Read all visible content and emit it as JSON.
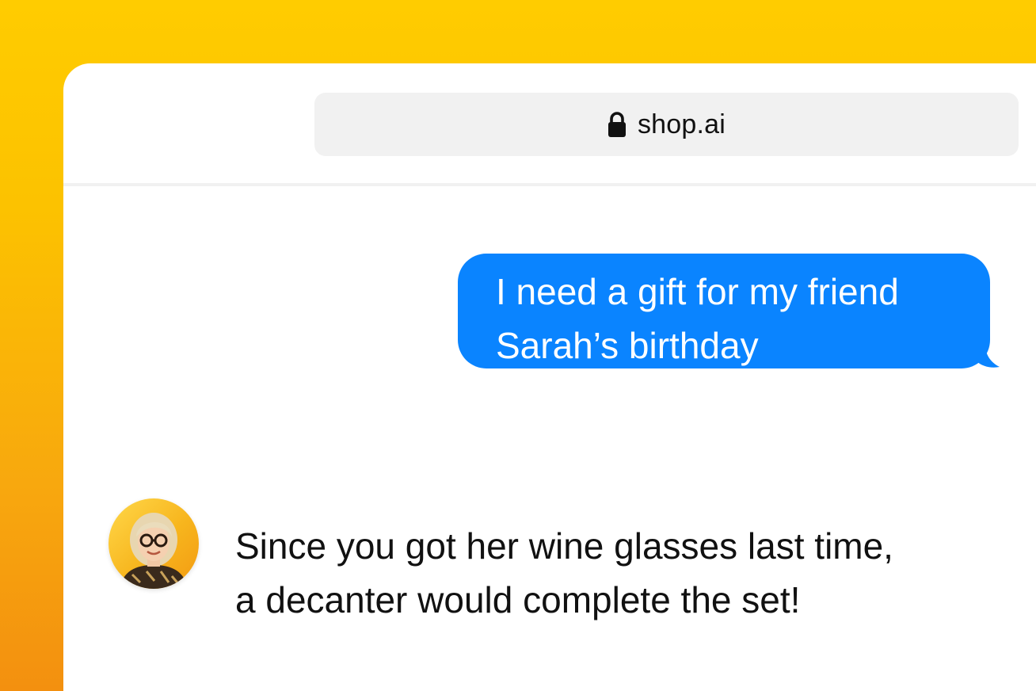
{
  "browser": {
    "address_bar": {
      "icon": "lock-icon",
      "url": "shop.ai"
    }
  },
  "chat": {
    "messages": [
      {
        "role": "user",
        "text": "I need a gift for my friend\nSarah’s birthday",
        "bubble_color": "#0a84ff"
      },
      {
        "role": "assistant",
        "avatar": "assistant-avatar",
        "text": "Since you got her wine glasses last time,\na decanter would complete the set!"
      }
    ]
  },
  "colors": {
    "background_top": "#ffcc00",
    "background_bottom": "#f3900f",
    "window": "#ffffff",
    "address_bar": "#f1f1f1"
  }
}
